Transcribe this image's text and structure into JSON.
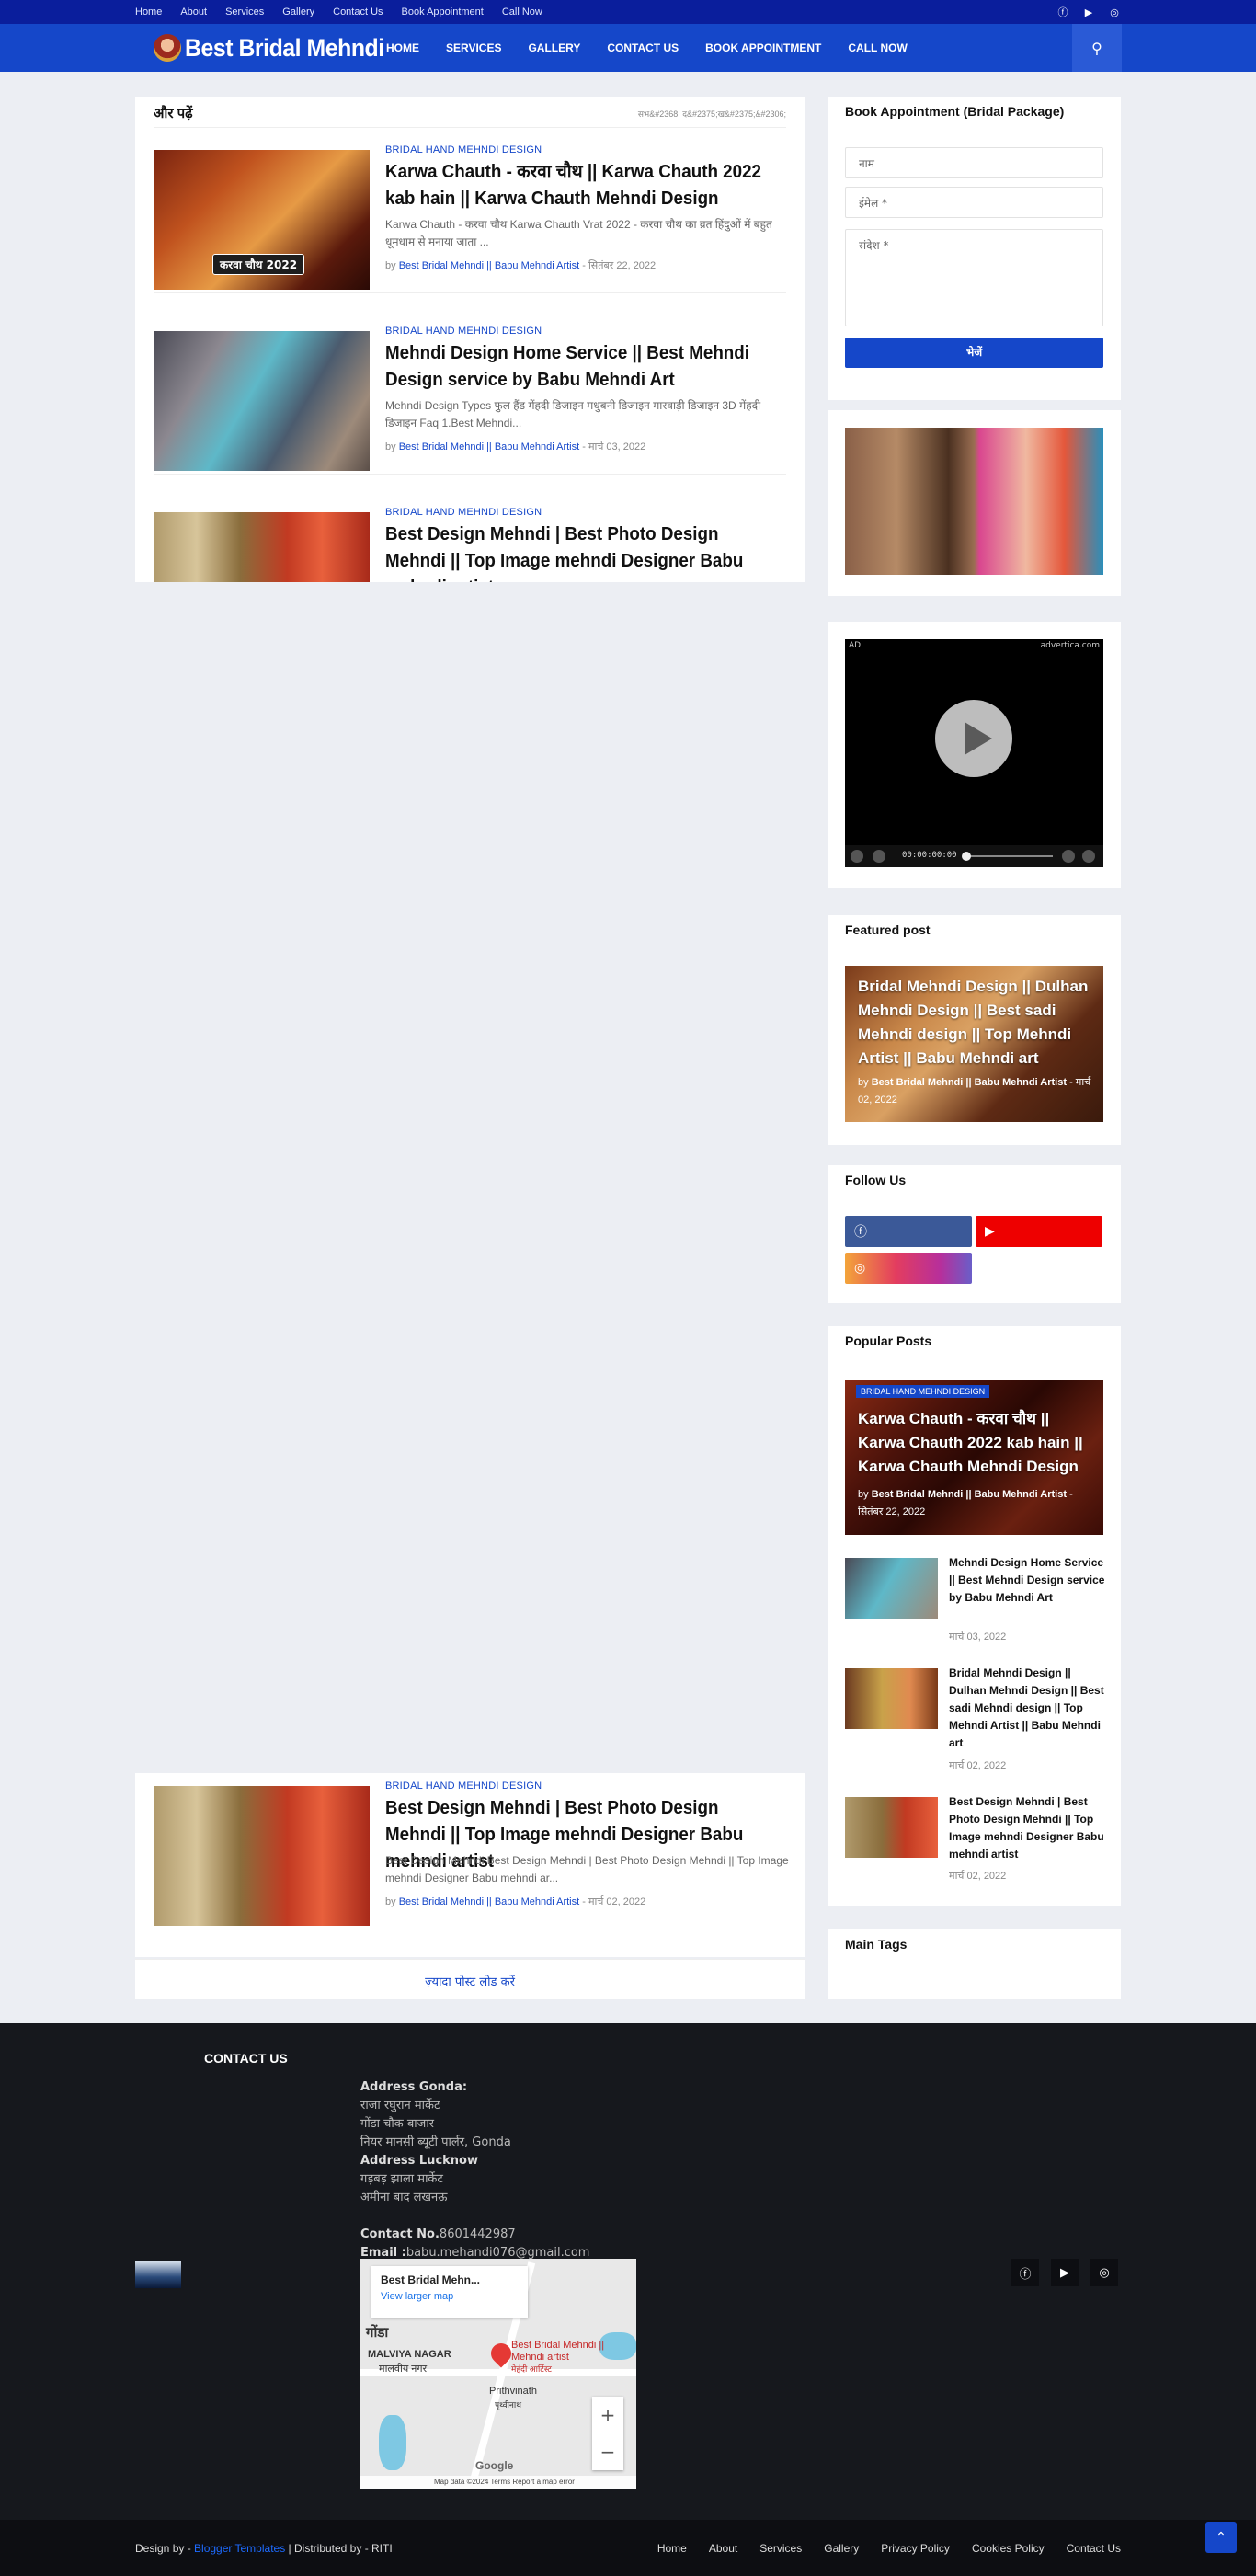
{
  "topbar": {
    "links": [
      "Home",
      "About",
      "Services",
      "Gallery",
      "Contact Us",
      "Book Appointment",
      "Call Now"
    ],
    "social_icons": [
      "facebook-icon",
      "youtube-icon",
      "instagram-icon"
    ]
  },
  "nav": {
    "logo_text": "Best Bridal Mehndi",
    "menu": [
      "HOME",
      "SERVICES",
      "GALLERY",
      "CONTACT US",
      "BOOK APPOINTMENT",
      "CALL NOW"
    ],
    "search_icon": "search-icon"
  },
  "more": {
    "heading": "और पढ़ें",
    "crumb": "सभ&#2368; द&#2375;ख&#2375;&#2306;",
    "posts": [
      {
        "category": "BRIDAL HAND MEHNDI DESIGN",
        "title": "Karwa Chauth - करवा चौथ || Karwa Chauth 2022 kab hain || Karwa Chauth Mehndi Design",
        "excerpt": "Karwa Chauth - करवा चौथ   Karwa Chauth Vrat 2022 - करवा चौथ का व्रत हिंदुओं में बहुत धूमधाम से मनाया जाता ...",
        "by": "by",
        "author": "Best Bridal Mehndi || Babu Mehndi Artist",
        "date": "- सितंबर 22, 2022",
        "thumb_label": "करवा चौथ 2022"
      },
      {
        "category": "BRIDAL HAND MEHNDI DESIGN",
        "title": "Mehndi Design Home Service || Best Mehndi Design service by Babu Mehndi Art",
        "excerpt": "Mehndi Design Types  फुल हैंड मेंहदी डिजाइन मधुबनी डिजाइन मारवाड़ी डिजाइन 3D मेंहदी डिजाइन Faq 1.Best Mehndi...",
        "by": "by",
        "author": "Best Bridal Mehndi || Babu Mehndi Artist",
        "date": "- मार्च 03, 2022"
      },
      {
        "category": "BRIDAL HAND MEHNDI DESIGN",
        "title": "Best Design Mehndi | Best Photo Design Mehndi || Top Image mehndi Designer Babu mehndi artist",
        "excerpt": "Best Design Mehndi Best Design Mehndi | Best Photo Design Mehndi || Top Image mehndi Designer Babu mehndi ar...",
        "by": "by",
        "author": "Best Bridal Mehndi || Babu Mehndi Artist",
        "date": "- मार्च 02, 2022"
      }
    ],
    "load_more": "ज़्यादा पोस्ट लोड करें"
  },
  "sidebar": {
    "book": {
      "title": "Book Appointment (Bridal Package)",
      "name_placeholder": "नाम",
      "email_placeholder": "ईमेल *",
      "message_placeholder": "संदेश *",
      "submit": "भेजें"
    },
    "ad": {
      "label": "AD",
      "brand": "advertica.com",
      "time": "00:00:00:00"
    },
    "featured": {
      "title": "Featured post",
      "post_title": "Bridal Mehndi Design || Dulhan Mehndi Design || Best sadi Mehndi design || Top Mehndi Artist || Babu Mehndi art",
      "by": "by",
      "author": "Best Bridal Mehndi || Babu Mehndi Artist",
      "date": "- मार्च 02, 2022"
    },
    "follow": {
      "title": "Follow Us",
      "icons": [
        "facebook-icon",
        "youtube-icon",
        "instagram-icon"
      ]
    },
    "popular": {
      "title": "Popular Posts",
      "top": {
        "category": "BRIDAL HAND MEHNDI DESIGN",
        "title": "Karwa Chauth - करवा चौथ || Karwa Chauth 2022 kab hain || Karwa Chauth Mehndi Design",
        "by": "by",
        "author": "Best Bridal Mehndi || Babu Mehndi Artist",
        "date": "- सितंबर 22, 2022"
      },
      "items": [
        {
          "title": "Mehndi Design Home Service || Best Mehndi Design service by Babu Mehndi Art",
          "date": "मार्च 03, 2022"
        },
        {
          "title": "Bridal Mehndi Design || Dulhan Mehndi Design || Best sadi Mehndi design || Top Mehndi Artist || Babu Mehndi art",
          "date": "मार्च 02, 2022"
        },
        {
          "title": "Best Design Mehndi | Best Photo Design Mehndi || Top Image mehndi Designer Babu mehndi artist",
          "date": "मार्च 02, 2022"
        }
      ]
    },
    "tags": {
      "title": "Main Tags"
    }
  },
  "footer": {
    "contact_title": "CONTACT US",
    "address_gonda_label": "Address Gonda:",
    "gonda_lines": [
      "राजा रघुरान मार्केट",
      "गोंडा चौक बाजार",
      "नियर मानसी ब्यूटी पार्लर, Gonda"
    ],
    "address_lucknow_label": "Address Lucknow",
    "lucknow_lines": [
      "गड़बड़ झाला मार्केट",
      "अमीना बाद लखनऊ"
    ],
    "contact_no_label": "Contact No.",
    "contact_no": "8601442987",
    "email_label": "Email :",
    "email": "babu.mehandi076@gmail.com",
    "map": {
      "place_name": "Best Bridal Mehn...",
      "view_larger": "View larger map",
      "pin_label": "Best Bridal Mehndi || Mehndi artist",
      "pin_sub": "मेहंदी आर्टिस्ट",
      "city": "गोंडा",
      "area1": "MALVIYA NAGAR",
      "area1_hi": "मालवीय नगर",
      "area2": "Prithvinath",
      "area2_hi": "पृथ्वीनाथ",
      "google": "Google",
      "attribution": "Map data ©2024   Terms   Report a map error"
    },
    "social_icons": [
      "facebook-icon",
      "youtube-icon",
      "instagram-icon"
    ]
  },
  "bottom": {
    "design_by": "Design by - ",
    "blogger": "Blogger Templates",
    "distributed": " | Distributed by - RITI",
    "links": [
      "Home",
      "About",
      "Services",
      "Gallery",
      "Privacy Policy",
      "Cookies Policy",
      "Contact Us"
    ]
  }
}
